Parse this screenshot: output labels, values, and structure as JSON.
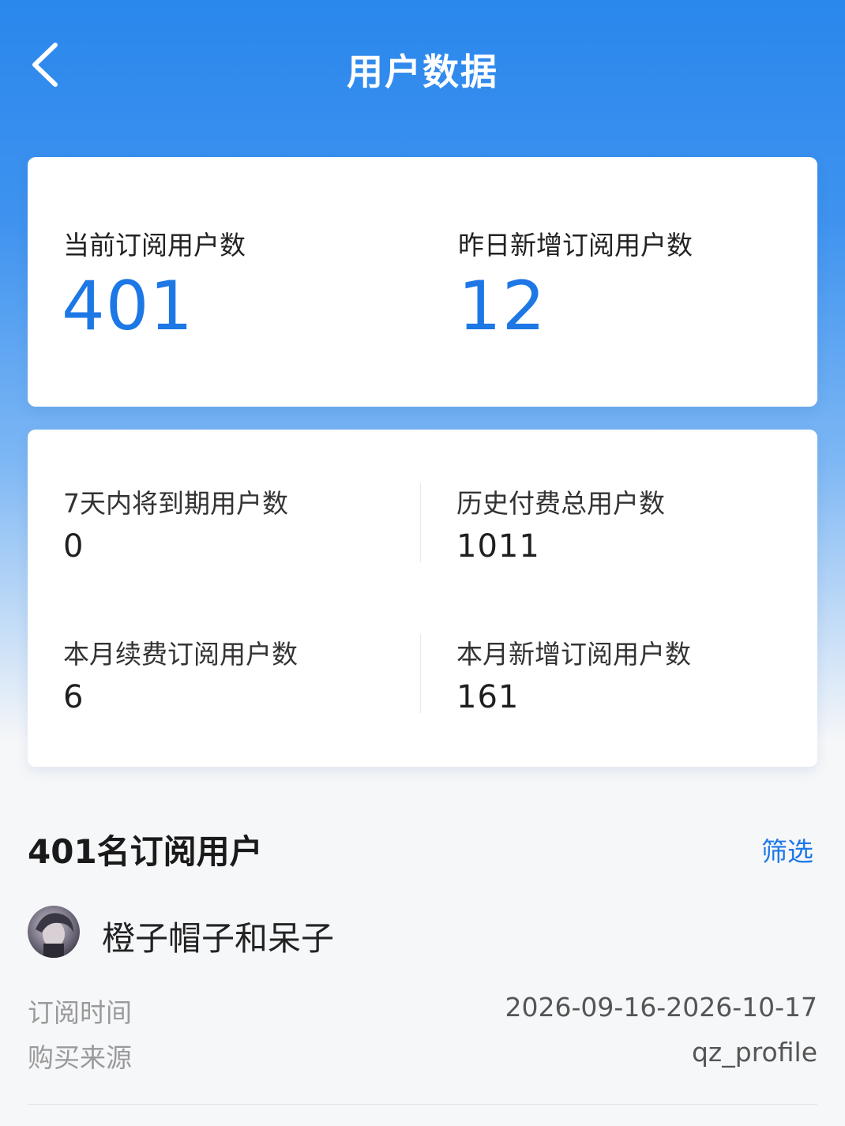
{
  "header": {
    "title": "用户数据"
  },
  "summary": {
    "current_subscribers_label": "当前订阅用户数",
    "current_subscribers_value": "401",
    "yesterday_new_label": "昨日新增订阅用户数",
    "yesterday_new_value": "12"
  },
  "stats": {
    "expiring_7d_label": "7天内将到期用户数",
    "expiring_7d_value": "0",
    "total_paid_label": "历史付费总用户数",
    "total_paid_value": "1011",
    "month_renew_label": "本月续费订阅用户数",
    "month_renew_value": "6",
    "month_new_label": "本月新增订阅用户数",
    "month_new_value": "161"
  },
  "list": {
    "title": "401名订阅用户",
    "filter_label": "筛选",
    "users": [
      {
        "name": "橙子帽子和呆子",
        "subscribe_time_label": "订阅时间",
        "subscribe_time_value": "2026-09-16-2026-10-17",
        "source_label": "购买来源",
        "source_value": "qz_profile"
      }
    ]
  },
  "colors": {
    "accent": "#1d78e6",
    "header_bg": "#2a87ec"
  },
  "icons": {
    "back": "chevron-left-icon"
  }
}
